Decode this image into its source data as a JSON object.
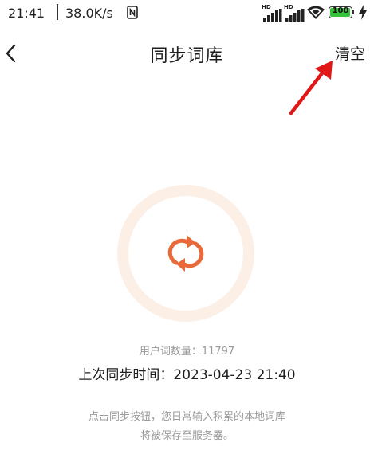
{
  "status_bar": {
    "time": "21:41",
    "network_speed": "38.0K/s",
    "sim1_label": "HD",
    "sim2_label": "HD",
    "battery": "100",
    "battery_level": 1.0,
    "icons": [
      "nfc-icon",
      "signal-icon",
      "signal-icon",
      "wifi-icon",
      "battery-icon",
      "charging-icon"
    ]
  },
  "header": {
    "title": "同步词库",
    "clear_label": "清空",
    "back_icon": "chevron-left-icon"
  },
  "sync": {
    "icon": "sync-icon",
    "ring_color": "#fcefe6",
    "icon_color": "#e8693a",
    "word_count": "用户词数量：11797",
    "last_sync": "上次同步时间：2023-04-23 21:40"
  },
  "description": {
    "line1": "点击同步按钮，您日常输入积累的本地词库",
    "line2": "将被保存至服务器。"
  },
  "annotation": {
    "arrow_color": "#e01818"
  }
}
